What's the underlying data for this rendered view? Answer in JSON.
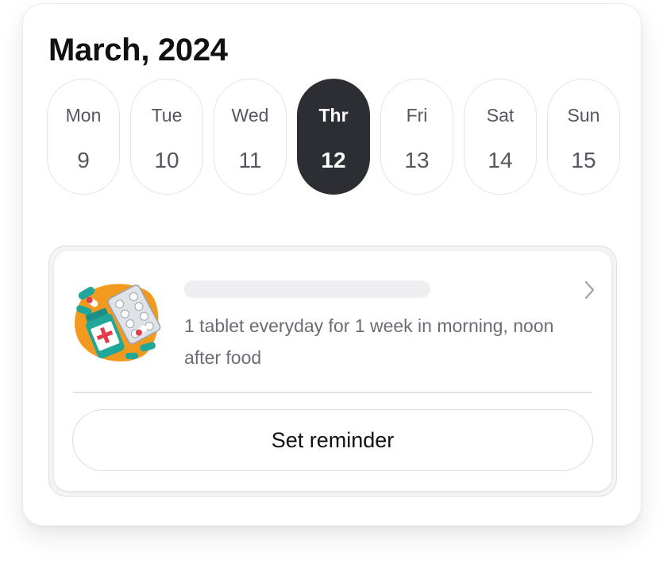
{
  "calendar": {
    "title": "March, 2024",
    "days": [
      {
        "name": "Mon",
        "num": "9",
        "selected": false
      },
      {
        "name": "Tue",
        "num": "10",
        "selected": false
      },
      {
        "name": "Wed",
        "num": "11",
        "selected": false
      },
      {
        "name": "Thr",
        "num": "12",
        "selected": true
      },
      {
        "name": "Fri",
        "num": "13",
        "selected": false
      },
      {
        "name": "Sat",
        "num": "14",
        "selected": false
      },
      {
        "name": "Sun",
        "num": "15",
        "selected": false
      }
    ]
  },
  "medication": {
    "image_icon": "medicine-pills-illustration",
    "description": "1 tablet everyday for 1 week in morning, noon after food",
    "chevron_icon": "chevron-right-icon",
    "reminder_label": "Set reminder"
  },
  "colors": {
    "selected_day_bg": "#2d2e33",
    "illustration_orange": "#f29a1f",
    "illustration_teal": "#21a79a"
  }
}
